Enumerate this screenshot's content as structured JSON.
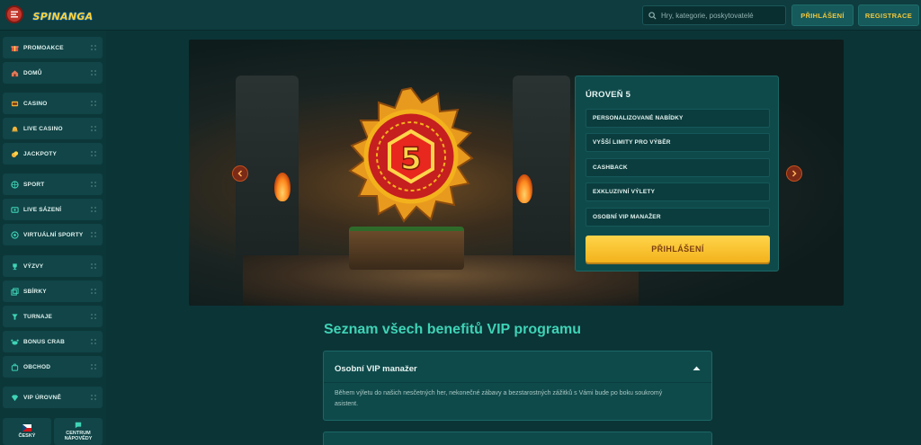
{
  "header": {
    "logo_text": "SPINANGA",
    "search_placeholder": "Hry, kategorie, poskytovatelé",
    "login_label": "PŘIHLÁŠENÍ",
    "register_label": "REGISTRACE"
  },
  "sidebar": {
    "items": [
      {
        "label": "PROMOAKCE",
        "icon": "gift-icon"
      },
      {
        "label": "DOMŮ",
        "icon": "home-icon"
      },
      {
        "label": "CASINO",
        "icon": "slot-icon"
      },
      {
        "label": "LIVE CASINO",
        "icon": "bell-icon"
      },
      {
        "label": "JACKPOTY",
        "icon": "coins-icon"
      },
      {
        "label": "SPORT",
        "icon": "ball-icon"
      },
      {
        "label": "LIVE SÁZENÍ",
        "icon": "live-bet-icon"
      },
      {
        "label": "VIRTUÁLNÍ SPORTY",
        "icon": "virtual-sport-icon"
      },
      {
        "label": "VÝZVY",
        "icon": "trophy-icon"
      },
      {
        "label": "SBÍRKY",
        "icon": "collection-icon"
      },
      {
        "label": "TURNAJE",
        "icon": "cup-icon"
      },
      {
        "label": "BONUS CRAB",
        "icon": "crab-icon"
      },
      {
        "label": "OBCHOD",
        "icon": "shop-icon"
      },
      {
        "label": "VIP ÚROVNĚ",
        "icon": "diamond-icon"
      }
    ],
    "language_label": "ČESKÝ",
    "help_label_1": "CENTRUM",
    "help_label_2": "NÁPOVĚDY"
  },
  "hero": {
    "badge_number": "5"
  },
  "level_panel": {
    "title": "ÚROVEŇ 5",
    "benefits": [
      "PERSONALIZOVANÉ NABÍDKY",
      "VYŠŠÍ LIMITY PRO VÝBĚR",
      "CASHBACK",
      "EXKLUZIVNÍ VÝLETY",
      "OSOBNÍ VIP MANAŽER"
    ],
    "login_label": "PŘIHLÁŠENÍ"
  },
  "benefits_section": {
    "title": "Seznam všech benefitů VIP programu",
    "accordion": [
      {
        "heading": "Osobní VIP manažer",
        "body": "Během výletu do našich nesčetných her, nekonečné zábavy a bezstarostných zážitků s Vámi bude po boku soukromý asistent."
      }
    ]
  },
  "colors": {
    "accent_gold": "#f3b21c",
    "accent_teal": "#3fd3b6",
    "background": "#0b3436"
  }
}
